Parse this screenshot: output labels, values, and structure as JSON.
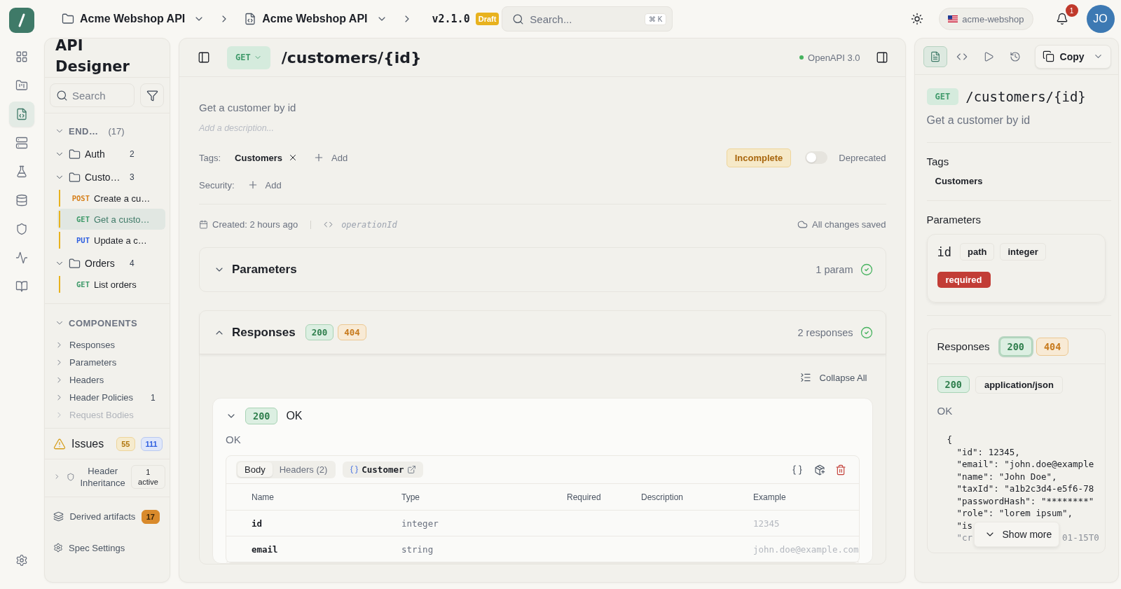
{
  "top_bar": {
    "breadcrumbs": [
      {
        "kind": "folder",
        "label": "Acme Webshop API"
      },
      {
        "kind": "spec",
        "label": "Acme Webshop API"
      }
    ],
    "version": "v2.1.0",
    "version_badge": "Draft",
    "search": {
      "placeholder": "Search...",
      "shortcut": "⌘ K"
    },
    "workspace": "acme-webshop",
    "notifications": "1",
    "avatar": "JO"
  },
  "rail": {
    "items": [
      {
        "kind": "grid",
        "selected": false
      },
      {
        "kind": "folder",
        "selected": false
      },
      {
        "kind": "spec",
        "selected": true
      },
      {
        "kind": "server",
        "selected": false
      },
      {
        "kind": "flask",
        "selected": false
      },
      {
        "kind": "database",
        "selected": false
      },
      {
        "kind": "shield",
        "selected": false
      },
      {
        "kind": "activity",
        "selected": false
      },
      {
        "kind": "book",
        "selected": false
      }
    ]
  },
  "sidebar": {
    "title": "API Designer",
    "search": {
      "placeholder": "Search"
    },
    "endpoints": {
      "label": "END…",
      "count": "(17)",
      "expanded": true,
      "groups": [
        {
          "name": "Auth",
          "count": "2",
          "expanded": true
        },
        {
          "name": "Custo…",
          "count": "3",
          "expanded": true,
          "children": [
            {
              "method": "POST",
              "label": "Create a cu…",
              "selected": false
            },
            {
              "method": "GET",
              "label": "Get a custo…",
              "selected": true
            },
            {
              "method": "PUT",
              "label": "Update a c…",
              "selected": false
            }
          ]
        },
        {
          "name": "Orders",
          "count": "4",
          "expanded": true,
          "children": [
            {
              "method": "GET",
              "label": "List orders",
              "selected": false
            }
          ]
        }
      ]
    },
    "components": {
      "label": "COMPONENTS",
      "expanded": true,
      "items": [
        {
          "label": "Responses"
        },
        {
          "label": "Parameters"
        },
        {
          "label": "Headers"
        },
        {
          "label": "Header Policies",
          "count": "1"
        },
        {
          "label": "Request Bodies",
          "faded": true
        }
      ]
    },
    "issues": {
      "label": "Issues",
      "warnings": "55",
      "infos": "111"
    },
    "header_inheritance": {
      "label": "Header Inheritance",
      "status": "1 active",
      "expanded": false
    },
    "derived": {
      "label": "Derived artifacts",
      "count": "17"
    },
    "settings": "Spec Settings"
  },
  "operation": {
    "method": "GET",
    "path": "/customers/{id}",
    "spec_version": "OpenAPI 3.0",
    "summary": "Get a customer by id",
    "description_placeholder": "Add a description...",
    "tags_label": "Tags:",
    "tags": [
      "Customers"
    ],
    "add_label": "Add",
    "status": "Incomplete",
    "deprecated": {
      "label": "Deprecated",
      "on": false
    },
    "security_label": "Security:",
    "security_add": "Add",
    "created": "Created: 2 hours ago",
    "operation_id_placeholder": "operationId",
    "save_status": "All changes saved"
  },
  "parameters_section": {
    "title": "Parameters",
    "summary": "1 param",
    "expanded": false,
    "valid": true
  },
  "responses_section": {
    "title": "Responses",
    "codes": [
      {
        "code": "200",
        "kind": "success"
      },
      {
        "code": "404",
        "kind": "client_error"
      }
    ],
    "summary": "2 responses",
    "expanded": true,
    "valid": true,
    "collapse_all": "Collapse All",
    "responses": [
      {
        "code": "200",
        "kind": "success",
        "title": "OK",
        "description": "OK",
        "expanded": true,
        "tabs": [
          {
            "label": "Body",
            "selected": true
          },
          {
            "label": "Headers (2)",
            "selected": false
          }
        ],
        "schema": "Customer",
        "table": {
          "columns": [
            "Name",
            "Type",
            "Required",
            "Description",
            "Example"
          ],
          "rows": [
            {
              "name": "id",
              "type": "integer",
              "example": "12345"
            },
            {
              "name": "email",
              "type": "string",
              "example": "john.doe@example.com"
            }
          ]
        }
      }
    ]
  },
  "preview": {
    "tabs": [
      {
        "kind": "doc",
        "selected": true
      },
      {
        "kind": "code",
        "selected": false
      },
      {
        "kind": "play",
        "selected": false
      },
      {
        "kind": "history",
        "selected": false
      }
    ],
    "copy": "Copy",
    "method": "GET",
    "path": "/customers/{id}",
    "summary": "Get a customer by id",
    "tags_title": "Tags",
    "tags": [
      "Customers"
    ],
    "parameters_title": "Parameters",
    "parameters": [
      {
        "name": "id",
        "location": "path",
        "type": "integer",
        "required": true,
        "required_label": "required"
      }
    ],
    "responses_title": "Responses",
    "codes": [
      {
        "code": "200",
        "kind": "success",
        "selected": true
      },
      {
        "code": "404",
        "kind": "client_error",
        "selected": false
      }
    ],
    "response": {
      "code": "200",
      "kind": "success",
      "content_type": "application/json",
      "description": "OK",
      "example_lines": [
        "{",
        "\"id\": 12345,",
        "\"email\": \"john.doe@example",
        "\"name\": \"John Doe\",",
        "\"taxId\": \"a1b2c3d4-e5f6-78",
        "\"passwordHash\": \"********\"",
        "\"role\": \"lorem ipsum\",",
        "\"is",
        "\"cr"
      ],
      "covered_line_tail": "01-15T0",
      "show_more": "Show more"
    }
  }
}
